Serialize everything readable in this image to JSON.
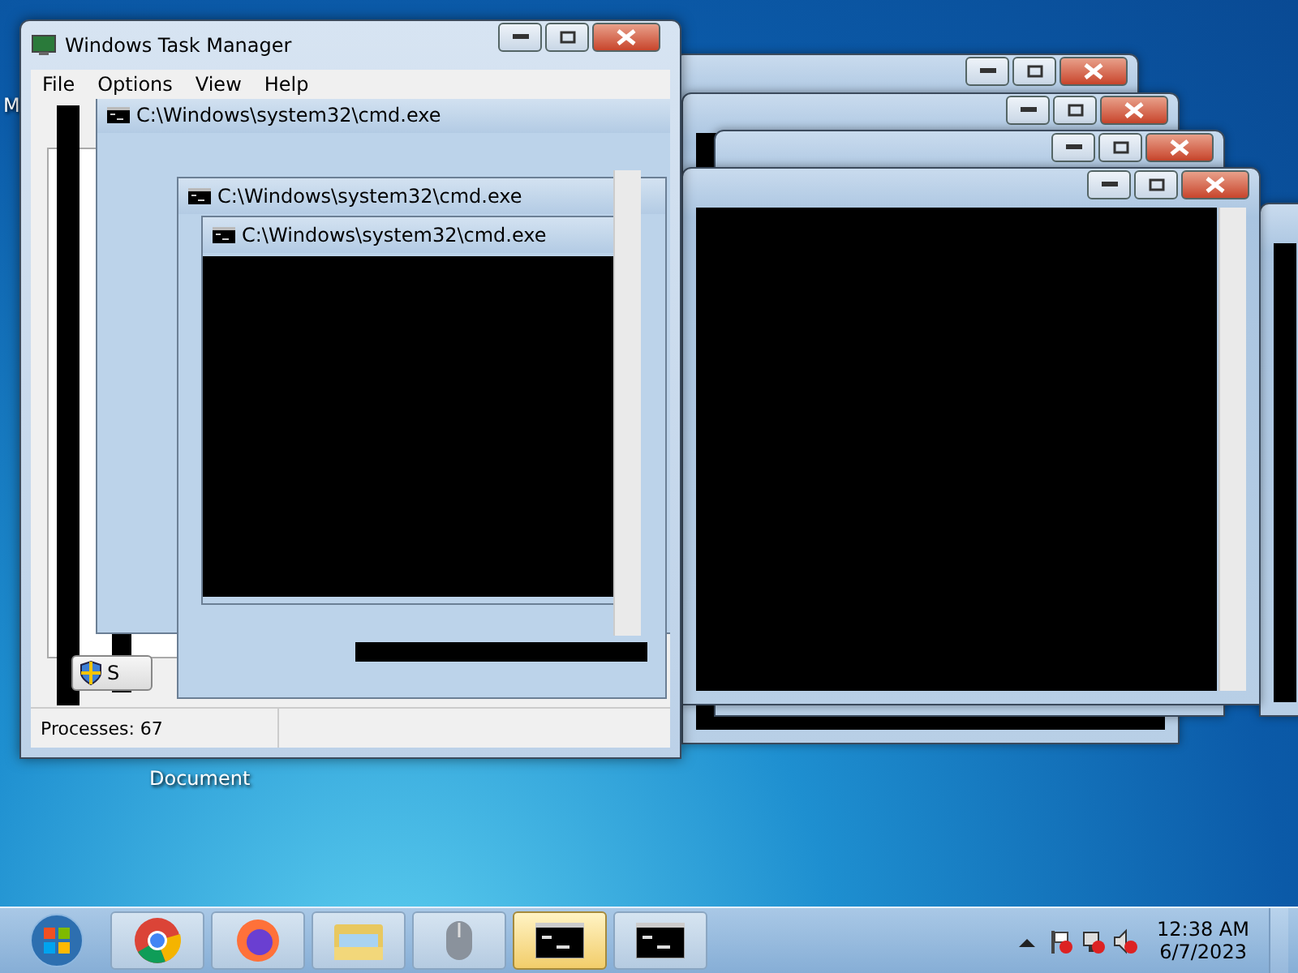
{
  "desktop": {
    "icons": [
      {
        "label": "M"
      },
      {
        "label": "Document"
      }
    ]
  },
  "task_manager": {
    "title": "Windows Task Manager",
    "menu": [
      "File",
      "Options",
      "View",
      "Help"
    ],
    "inner_windows": [
      {
        "title": "C:\\Windows\\system32\\cmd.exe"
      },
      {
        "title": "C:\\Windows\\system32\\cmd.exe"
      },
      {
        "title": "C:\\Windows\\system32\\cmd.exe"
      }
    ],
    "button_label": "S",
    "status": "Processes: 67"
  },
  "taskbar": {
    "items": [
      {
        "kind": "start",
        "selected": false
      },
      {
        "kind": "chrome",
        "selected": false
      },
      {
        "kind": "firefox",
        "selected": false
      },
      {
        "kind": "folder",
        "selected": false
      },
      {
        "kind": "mouse",
        "selected": false
      },
      {
        "kind": "console",
        "selected": true
      },
      {
        "kind": "console",
        "selected": false
      }
    ],
    "time": "12:38 AM",
    "date": "6/7/2023"
  }
}
